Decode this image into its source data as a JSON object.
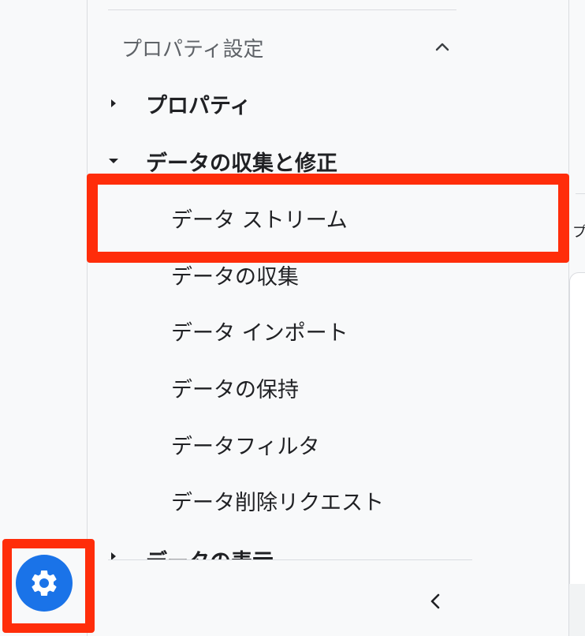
{
  "colors": {
    "accent": "#1a73e8",
    "highlight": "#ff2d0a",
    "text": "#202124",
    "muted": "#5f6368",
    "divider": "#dadce0"
  },
  "section": {
    "title": "プロパティ設定",
    "chevron_icon": "chevron-up-icon"
  },
  "nav": {
    "property": {
      "label": "プロパティ",
      "icon": "caret-right-icon"
    },
    "data_collection": {
      "label": "データの収集と修正",
      "icon": "caret-down-icon",
      "children": [
        {
          "label": "データ ストリーム"
        },
        {
          "label": "データの収集"
        },
        {
          "label": "データ インポート"
        },
        {
          "label": "データの保持"
        },
        {
          "label": "データフィルタ"
        },
        {
          "label": "データ削除リクエスト"
        }
      ]
    },
    "data_display": {
      "label": "データの表示",
      "icon": "caret-right-icon"
    }
  },
  "footer": {
    "collapse_icon": "chevron-left-icon",
    "settings_icon": "gear-icon"
  },
  "right_edge_glyph": "プ"
}
